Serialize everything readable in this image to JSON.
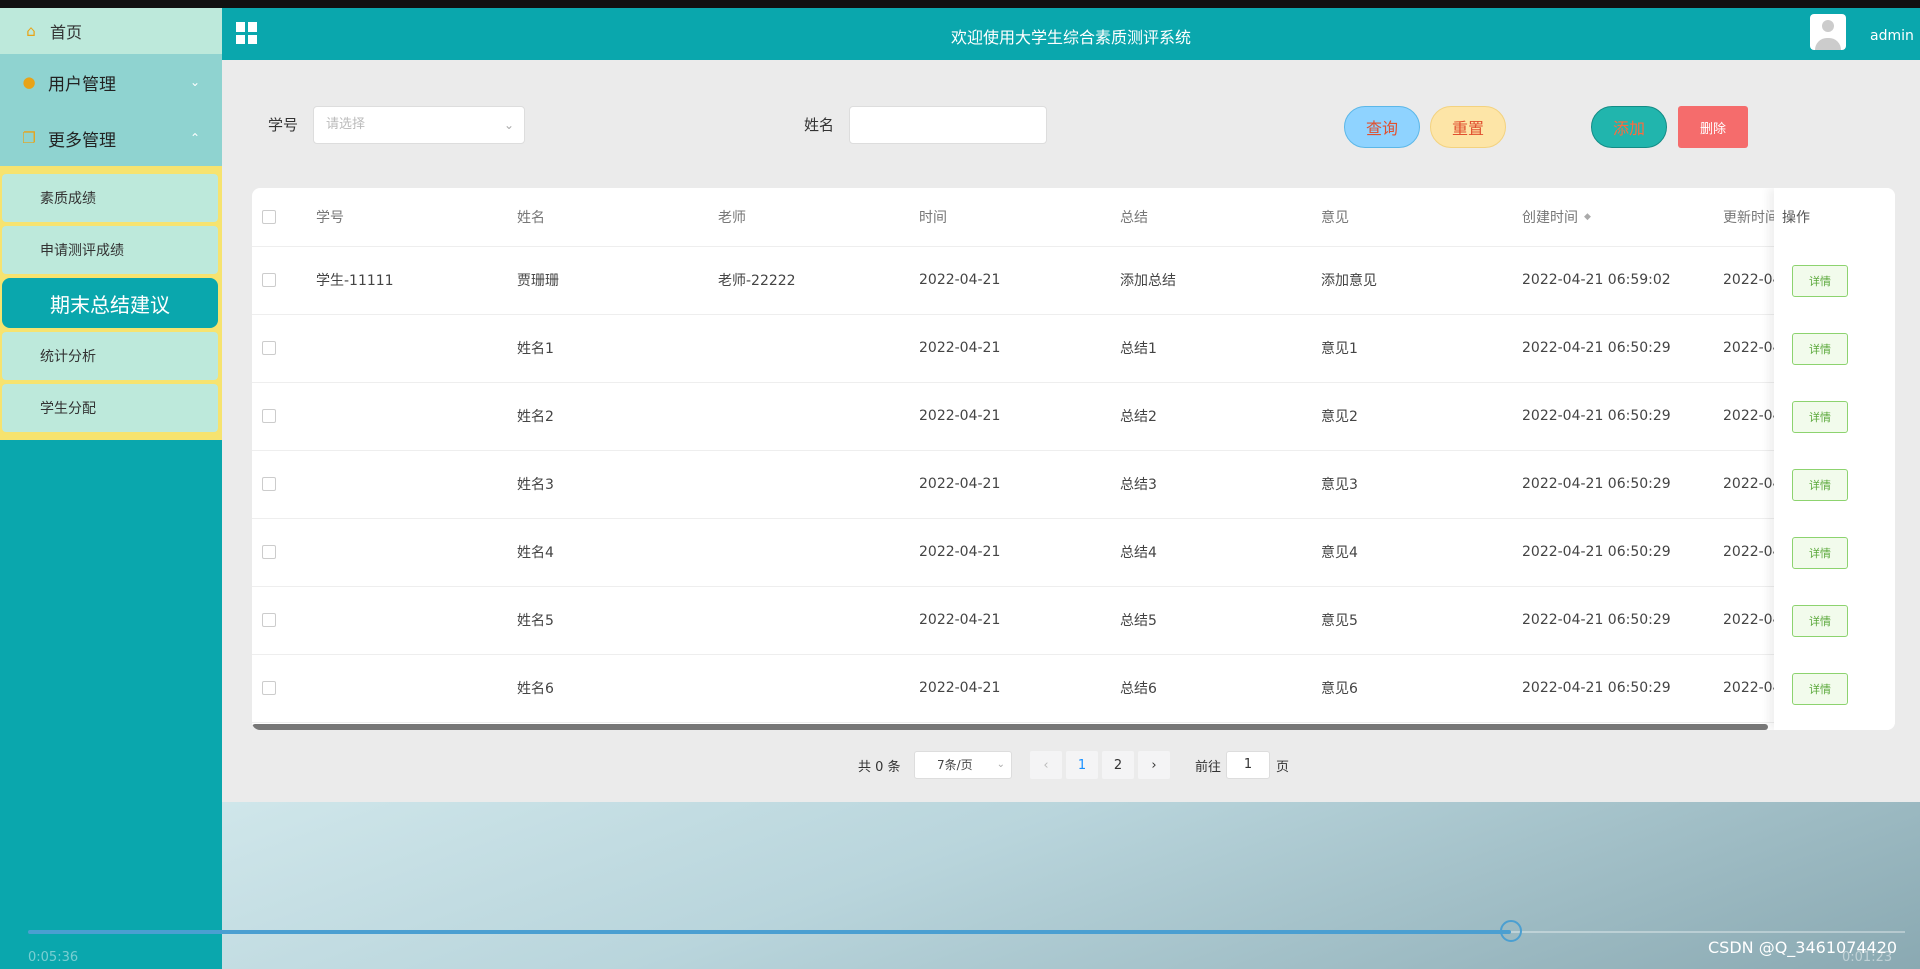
{
  "header": {
    "title": "欢迎使用大学生综合素质测评系统",
    "username": "admin"
  },
  "sidebar": {
    "home": "首页",
    "groups": [
      {
        "label": "用户管理",
        "chevron": "⌄"
      },
      {
        "label": "更多管理",
        "chevron": "⌃"
      }
    ],
    "items": [
      {
        "label": "素质成绩"
      },
      {
        "label": "申请测评成绩"
      },
      {
        "label": "期末总结建议"
      },
      {
        "label": "统计分析"
      },
      {
        "label": "学生分配"
      }
    ]
  },
  "search": {
    "student_id_label": "学号",
    "student_id_placeholder": "请选择",
    "name_label": "姓名",
    "name_value": ""
  },
  "actions": {
    "query": "查询",
    "reset": "重置",
    "add": "添加",
    "delete": "删除"
  },
  "table": {
    "columns": [
      "学号",
      "姓名",
      "老师",
      "时间",
      "总结",
      "意见",
      "创建时间",
      "更新时间",
      "操作"
    ],
    "rows": [
      {
        "id": "学生-11111",
        "name": "贾珊珊",
        "teacher": "老师-22222",
        "date": "2022-04-21",
        "summary": "添加总结",
        "opinion": "添加意见",
        "created": "2022-04-21 06:59:02",
        "updated": "2022-04",
        "op": "详情"
      },
      {
        "id": "",
        "name": "姓名1",
        "teacher": "",
        "date": "2022-04-21",
        "summary": "总结1",
        "opinion": "意见1",
        "created": "2022-04-21 06:50:29",
        "updated": "2022-04",
        "op": "详情"
      },
      {
        "id": "",
        "name": "姓名2",
        "teacher": "",
        "date": "2022-04-21",
        "summary": "总结2",
        "opinion": "意见2",
        "created": "2022-04-21 06:50:29",
        "updated": "2022-04",
        "op": "详情"
      },
      {
        "id": "",
        "name": "姓名3",
        "teacher": "",
        "date": "2022-04-21",
        "summary": "总结3",
        "opinion": "意见3",
        "created": "2022-04-21 06:50:29",
        "updated": "2022-04",
        "op": "详情"
      },
      {
        "id": "",
        "name": "姓名4",
        "teacher": "",
        "date": "2022-04-21",
        "summary": "总结4",
        "opinion": "意见4",
        "created": "2022-04-21 06:50:29",
        "updated": "2022-04",
        "op": "详情"
      },
      {
        "id": "",
        "name": "姓名5",
        "teacher": "",
        "date": "2022-04-21",
        "summary": "总结5",
        "opinion": "意见5",
        "created": "2022-04-21 06:50:29",
        "updated": "2022-04",
        "op": "详情"
      },
      {
        "id": "",
        "name": "姓名6",
        "teacher": "",
        "date": "2022-04-21",
        "summary": "总结6",
        "opinion": "意见6",
        "created": "2022-04-21 06:50:29",
        "updated": "2022-04",
        "op": "详情"
      }
    ]
  },
  "pagination": {
    "total": "共 0 条",
    "page_size": "7条/页",
    "pages": [
      "1",
      "2"
    ],
    "current_page": "1",
    "goto_label": "前往",
    "goto_value": "1",
    "page_suffix": "页"
  },
  "video": {
    "elapsed": "0:05:36",
    "remaining": "0:01:23",
    "progress": 0.79
  },
  "watermark": "CSDN @Q_3461074420",
  "colors": {
    "teal": "#0aa7ad",
    "submenu_bg": "#f6e36f",
    "light_mint": "#bde9db"
  }
}
